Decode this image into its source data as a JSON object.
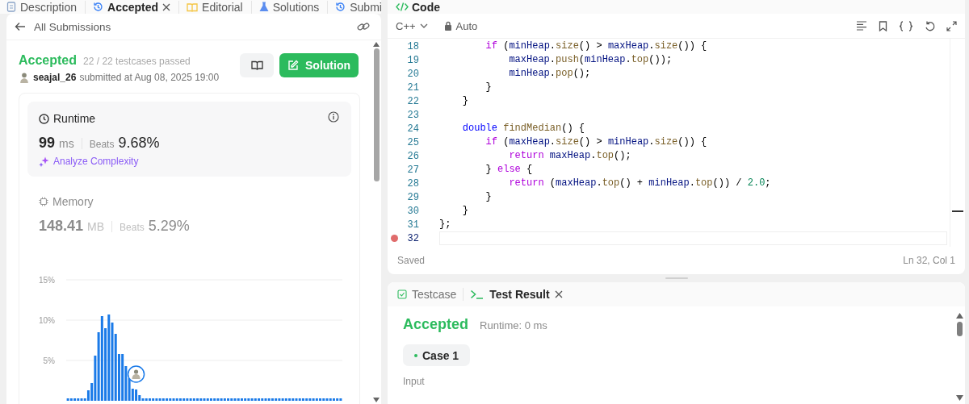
{
  "problem_tabs": [
    {
      "label": "Description",
      "kind": "document",
      "selected": false,
      "closable": false
    },
    {
      "label": "Accepted",
      "kind": "history",
      "selected": true,
      "closable": true
    },
    {
      "label": "Editorial",
      "kind": "book",
      "selected": false,
      "closable": false
    },
    {
      "label": "Solutions",
      "kind": "flask",
      "selected": false,
      "closable": false
    },
    {
      "label": "Submi",
      "kind": "history",
      "selected": false,
      "closable": false
    }
  ],
  "submission": {
    "back_label": "All Submissions",
    "status": "Accepted",
    "testcases": "22 / 22 testcases passed",
    "user": "seajal_26",
    "submitted": "submitted at Aug 08, 2025 19:00",
    "solution_button": "Solution",
    "metrics": [
      {
        "kind": "runtime",
        "label": "Runtime",
        "value": "99",
        "unit": "ms",
        "beats_label": "Beats",
        "beats": "9.68%",
        "selected": true,
        "action": "Analyze Complexity"
      },
      {
        "kind": "memory",
        "label": "Memory",
        "value": "148.41",
        "unit": "MB",
        "beats_label": "Beats",
        "beats": "5.29%",
        "selected": false
      }
    ],
    "chart_data": {
      "type": "bar",
      "ylim": [
        0,
        15
      ],
      "grid": true,
      "yticks": [
        {
          "value": 5,
          "label": "5%"
        },
        {
          "value": 10,
          "label": "10%"
        },
        {
          "value": 15,
          "label": "15%"
        }
      ],
      "values": [
        0.3,
        0.3,
        0.3,
        0.3,
        0.3,
        0.3,
        1.3,
        2.2,
        5.6,
        8.5,
        10.5,
        9.0,
        10.7,
        9.7,
        8.3,
        5.8,
        5.8,
        4.3,
        2.8,
        1.5,
        1.4,
        0.7,
        0.3,
        0.3,
        0.3,
        0.3,
        0.3,
        0.3,
        0.3,
        0.3,
        0.3,
        0.3,
        0.3,
        0.3,
        0.3,
        0.3,
        0.3,
        0.3,
        0.3,
        0.3,
        0.3,
        0.3,
        0.3,
        0.3,
        0.3,
        0.3,
        0.3,
        0.3,
        0.3,
        0.3,
        0.3,
        0.3,
        0.3,
        0.3,
        0.3,
        0.3,
        0.3,
        0.3,
        0.3,
        0.3,
        0.3,
        0.3,
        0.3,
        0.3,
        0.3,
        0.3,
        0.3,
        0.3,
        0.3,
        0.3,
        0.3,
        0.3,
        0.3,
        0.3,
        0.3,
        0.3,
        0.3,
        0.3,
        0.3,
        0.3,
        0.3
      ]
    }
  },
  "code_header": {
    "title": "Code"
  },
  "editor": {
    "language": "C++",
    "mode": "Auto",
    "status": "Saved",
    "cursor": "Ln 32, Col 1",
    "lines": [
      {
        "number": "18",
        "active": false,
        "code": [
          {
            "text": "        if",
            "kind": "keyword"
          },
          {
            "text": " (",
            "kind": "plain"
          },
          {
            "text": "minHeap",
            "kind": "variable"
          },
          {
            "text": ".",
            "kind": "plain"
          },
          {
            "text": "size",
            "kind": "function"
          },
          {
            "text": "() > ",
            "kind": "plain"
          },
          {
            "text": "maxHeap",
            "kind": "variable"
          },
          {
            "text": ".",
            "kind": "plain"
          },
          {
            "text": "size",
            "kind": "function"
          },
          {
            "text": "()) {",
            "kind": "plain"
          }
        ]
      },
      {
        "number": "19",
        "active": false,
        "code": [
          {
            "text": "            maxHeap",
            "kind": "variable"
          },
          {
            "text": ".",
            "kind": "plain"
          },
          {
            "text": "push",
            "kind": "function"
          },
          {
            "text": "(",
            "kind": "plain"
          },
          {
            "text": "minHeap",
            "kind": "variable"
          },
          {
            "text": ".",
            "kind": "plain"
          },
          {
            "text": "top",
            "kind": "function"
          },
          {
            "text": "());",
            "kind": "plain"
          }
        ]
      },
      {
        "number": "20",
        "active": false,
        "code": [
          {
            "text": "            minHeap",
            "kind": "variable"
          },
          {
            "text": ".",
            "kind": "plain"
          },
          {
            "text": "pop",
            "kind": "function"
          },
          {
            "text": "();",
            "kind": "plain"
          }
        ]
      },
      {
        "number": "21",
        "active": false,
        "code": [
          {
            "text": "        }",
            "kind": "plain"
          }
        ]
      },
      {
        "number": "22",
        "active": false,
        "code": [
          {
            "text": "    }",
            "kind": "plain"
          }
        ]
      },
      {
        "number": "23",
        "active": false
      },
      {
        "number": "24",
        "active": false,
        "code": [
          {
            "text": "    double",
            "kind": "type"
          },
          {
            "text": " findMedian",
            "kind": "function"
          },
          {
            "text": "() {",
            "kind": "plain"
          }
        ]
      },
      {
        "number": "25",
        "active": false,
        "code": [
          {
            "text": "        if",
            "kind": "keyword"
          },
          {
            "text": " (",
            "kind": "plain"
          },
          {
            "text": "maxHeap",
            "kind": "variable"
          },
          {
            "text": ".",
            "kind": "plain"
          },
          {
            "text": "size",
            "kind": "function"
          },
          {
            "text": "() > ",
            "kind": "plain"
          },
          {
            "text": "minHeap",
            "kind": "variable"
          },
          {
            "text": ".",
            "kind": "plain"
          },
          {
            "text": "size",
            "kind": "function"
          },
          {
            "text": "()) {",
            "kind": "plain"
          }
        ]
      },
      {
        "number": "26",
        "active": false,
        "code": [
          {
            "text": "            return",
            "kind": "keyword"
          },
          {
            "text": " maxHeap",
            "kind": "variable"
          },
          {
            "text": ".",
            "kind": "plain"
          },
          {
            "text": "top",
            "kind": "function"
          },
          {
            "text": "();",
            "kind": "plain"
          }
        ]
      },
      {
        "number": "27",
        "active": false,
        "code": [
          {
            "text": "        } ",
            "kind": "plain"
          },
          {
            "text": "else",
            "kind": "keyword"
          },
          {
            "text": " {",
            "kind": "plain"
          }
        ]
      },
      {
        "number": "28",
        "active": false,
        "code": [
          {
            "text": "            return",
            "kind": "keyword"
          },
          {
            "text": " (",
            "kind": "plain"
          },
          {
            "text": "maxHeap",
            "kind": "variable"
          },
          {
            "text": ".",
            "kind": "plain"
          },
          {
            "text": "top",
            "kind": "function"
          },
          {
            "text": "() + ",
            "kind": "plain"
          },
          {
            "text": "minHeap",
            "kind": "variable"
          },
          {
            "text": ".",
            "kind": "plain"
          },
          {
            "text": "top",
            "kind": "function"
          },
          {
            "text": "()) / ",
            "kind": "plain"
          },
          {
            "text": "2.0",
            "kind": "number"
          },
          {
            "text": ";",
            "kind": "plain"
          }
        ]
      },
      {
        "number": "29",
        "active": false,
        "code": [
          {
            "text": "        }",
            "kind": "plain"
          }
        ]
      },
      {
        "number": "30",
        "active": false,
        "code": [
          {
            "text": "    }",
            "kind": "plain"
          }
        ]
      },
      {
        "number": "31",
        "active": false,
        "code": [
          {
            "text": "};",
            "kind": "plain"
          }
        ]
      },
      {
        "number": "32",
        "active": true
      }
    ]
  },
  "result": {
    "tabs": [
      {
        "label": "Testcase",
        "kind": "check",
        "selected": false,
        "closable": false
      },
      {
        "label": "Test Result",
        "kind": "terminal",
        "selected": true,
        "closable": true
      }
    ],
    "verdict": "Accepted",
    "runtime": "Runtime: 0 ms",
    "cases": [
      {
        "label": "Case 1",
        "selected": true
      }
    ],
    "input_label": "Input"
  }
}
